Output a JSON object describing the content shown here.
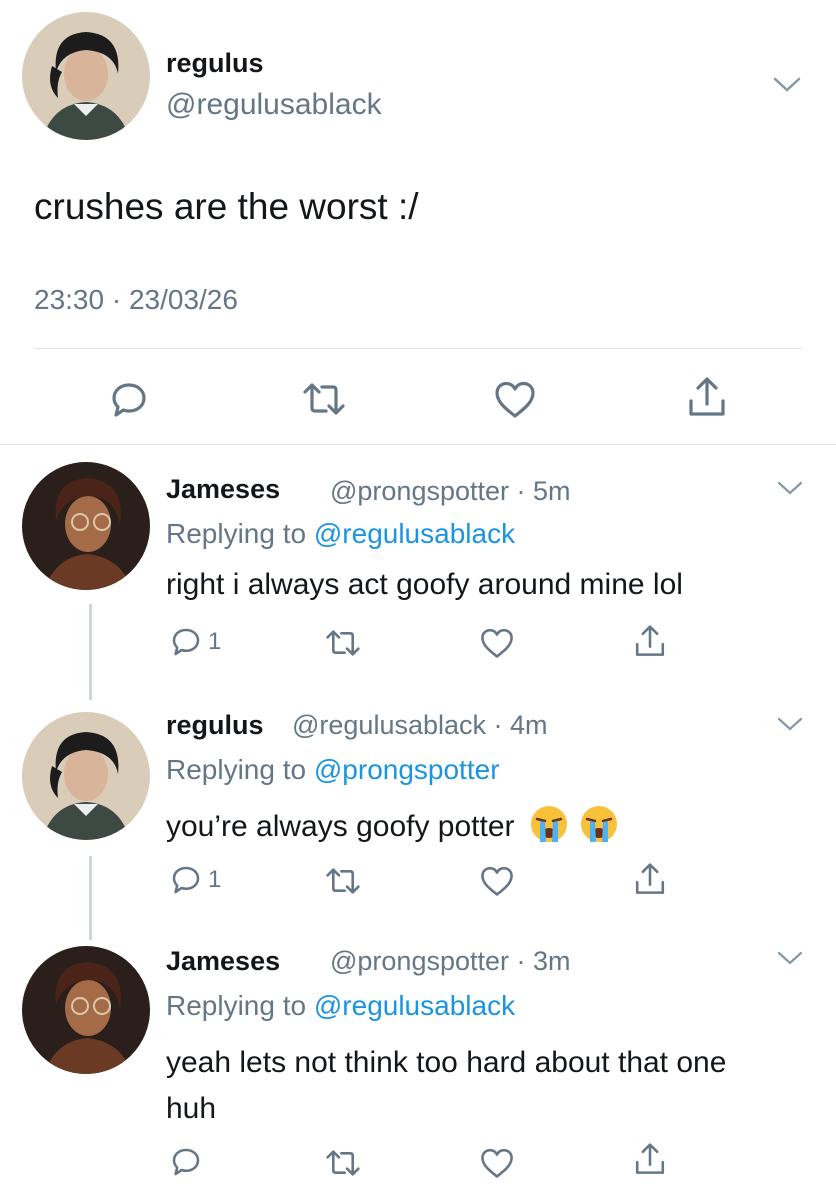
{
  "main_tweet": {
    "name": "regulus",
    "handle": "@regulusablack",
    "text": "crushes are the worst :/",
    "timestamp": "23:30 · 23/03/26"
  },
  "replies": [
    {
      "name": "Jameses",
      "handle_time": "@prongspotter · 5m",
      "replying_prefix": "Replying to",
      "replying_to": "@regulusablack",
      "text": "right i always act goofy around mine lol",
      "reply_count": "1"
    },
    {
      "name": "regulus",
      "handle_time": "@regulusablack · 4m",
      "replying_prefix": "Replying to",
      "replying_to": "@prongspotter",
      "text": "you’re always goofy potter",
      "reply_count": "1"
    },
    {
      "name": "Jameses",
      "handle_time": "@prongspotter · 3m",
      "replying_prefix": "Replying to",
      "replying_to": "@regulusablack",
      "text": "yeah lets not think too hard about that one huh",
      "reply_count": ""
    }
  ],
  "icons": [
    "reply-icon",
    "retweet-icon",
    "like-icon",
    "share-icon",
    "chevron-down-icon",
    "crying-face-emoji"
  ],
  "colors": {
    "link": "#1b95e0",
    "secondary_text": "#657786",
    "divider": "#e1e8ed"
  }
}
